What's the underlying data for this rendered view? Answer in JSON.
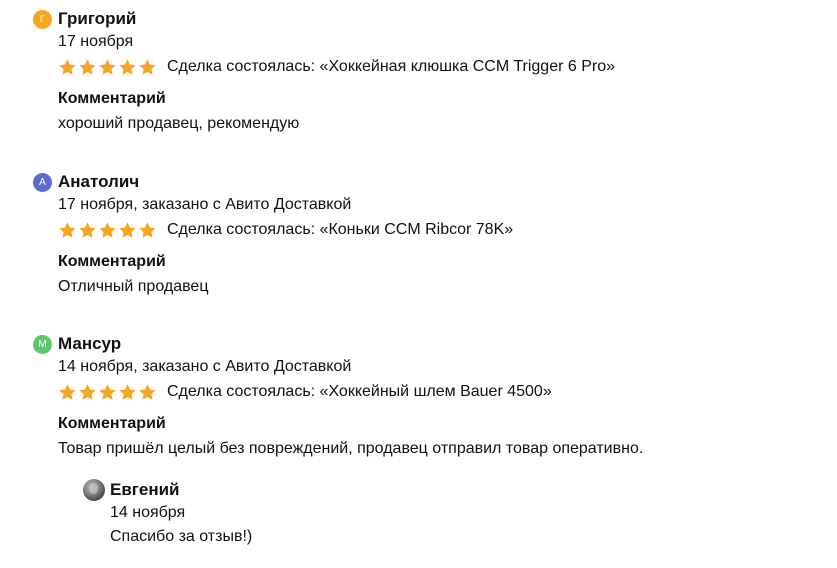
{
  "reviews": [
    {
      "avatar_letter": "Г",
      "avatar_color": "#f5a623",
      "author": "Григорий",
      "meta": "17 ноября",
      "rating": 5,
      "deal": "Сделка состоялась: «Хоккейная клюшка CCM Trigger 6 Pro»",
      "comment_title": "Комментарий",
      "comment": "хороший продавец, рекомендую"
    },
    {
      "avatar_letter": "А",
      "avatar_color": "#5b6bcf",
      "author": "Анатолич",
      "meta": "17 ноября, заказано с Авито Доставкой",
      "rating": 5,
      "deal": "Сделка состоялась: «Коньки CCM Ribcor 78K»",
      "comment_title": "Комментарий",
      "comment": "Отличный продавец"
    },
    {
      "avatar_letter": "М",
      "avatar_color": "#5cc86a",
      "author": "Мансур",
      "meta": "14 ноября, заказано с Авито Доставкой",
      "rating": 5,
      "deal": "Сделка состоялась: «Хоккейный шлем Bauer 4500»",
      "comment_title": "Комментарий",
      "comment": "Товар пришёл целый без повреждений, продавец отправил товар оперативно."
    }
  ],
  "reply": {
    "author": "Евгений",
    "date": "14 ноября",
    "text": "Спасибо за отзыв!)"
  },
  "colors": {
    "star": "#f5a623"
  }
}
